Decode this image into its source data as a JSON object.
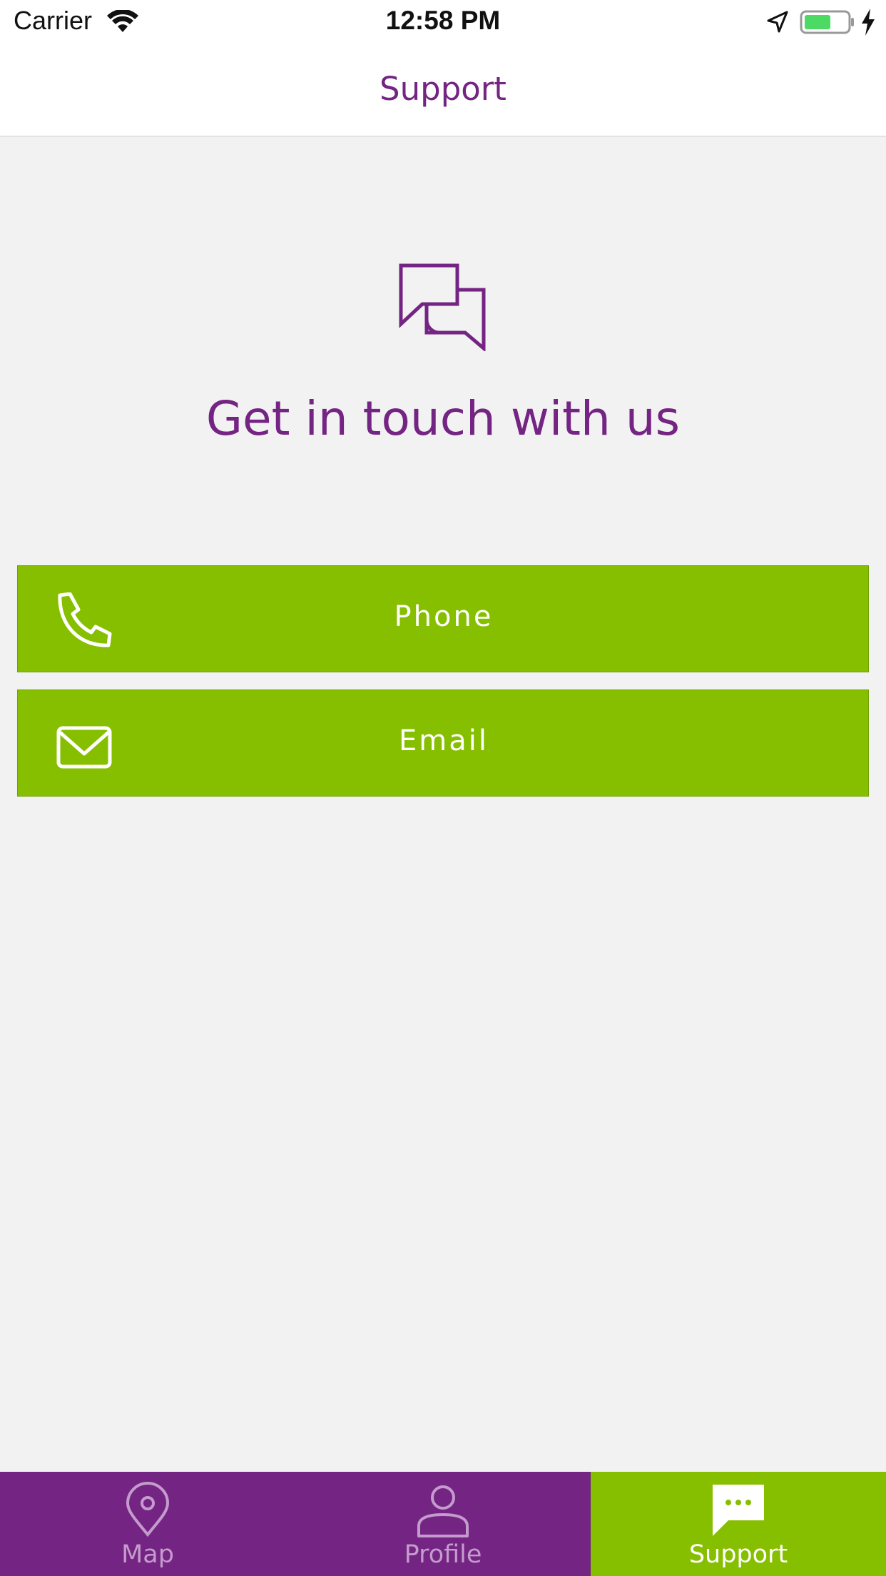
{
  "status_bar": {
    "carrier": "Carrier",
    "time": "12:58 PM",
    "icons": [
      "wifi-icon",
      "location-arrow-icon",
      "battery-icon",
      "charging-bolt-icon"
    ],
    "battery_color": "#4cd964"
  },
  "nav": {
    "title": "Support"
  },
  "main": {
    "icon": "chat-bubbles-icon",
    "heading": "Get in touch with us",
    "buttons": [
      {
        "label": "Phone",
        "icon": "phone-icon"
      },
      {
        "label": "Email",
        "icon": "envelope-icon"
      }
    ]
  },
  "tabs": [
    {
      "label": "Map",
      "icon": "map-pin-icon",
      "active": false
    },
    {
      "label": "Profile",
      "icon": "user-icon",
      "active": false
    },
    {
      "label": "Support",
      "icon": "chat-bubble-icon",
      "active": true
    }
  ],
  "colors": {
    "brand_purple": "#742482",
    "brand_green": "#86bf00",
    "background": "#f2f2f3",
    "inactive_tab_text": "#c49bcd"
  }
}
